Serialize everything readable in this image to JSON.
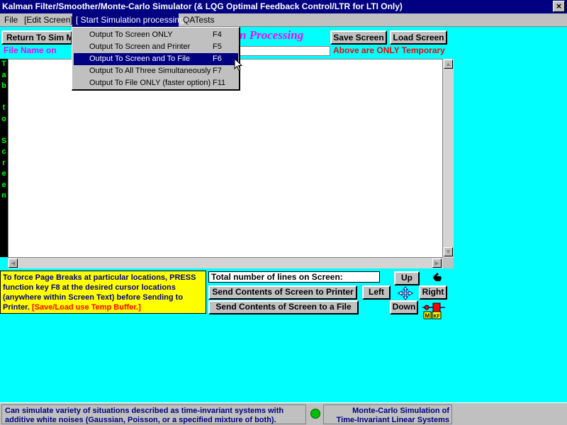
{
  "window": {
    "title": "Kalman Filter/Smoother/Monte-Carlo Simulator (& LQG Optimal Feedback Control/LTR for LTI Only)",
    "close_glyph": "×"
  },
  "menu": {
    "file": "File",
    "edit_screen": "[Edit Screen]",
    "start_sim": "[ Start Simulation processing ]",
    "qatests": "QATests"
  },
  "dropdown": {
    "items": [
      {
        "label": "Output To Screen ONLY",
        "key": "F4"
      },
      {
        "label": "Output To Screen and Printer",
        "key": "F5"
      },
      {
        "label": "Output To Screen and To File",
        "key": "F6"
      },
      {
        "label": "Output To All Three Simultaneously",
        "key": "F7"
      },
      {
        "label": "Output To File ONLY (faster option)",
        "key": "F11"
      }
    ],
    "selected_index": 2
  },
  "toolbar": {
    "return_label": "Return To Sim Menu",
    "processing_title": "n Processing",
    "save_screen": "Save Screen",
    "load_screen": "Load Screen",
    "file_name_label": "File Name on",
    "file_name_value": "",
    "temp_note": "Above are ONLY Temporary"
  },
  "tab_strip": {
    "letters": [
      "T",
      "a",
      "b",
      "",
      "t",
      "o",
      "",
      "S",
      "c",
      "r",
      "e",
      "e",
      "n"
    ]
  },
  "note": {
    "text": "To force Page Breaks at particular locations, PRESS function key F8 at the desired cursor locations (anywhere within Screen Text) before Sending to Printer.",
    "red_text": "[Save/Load use Temp Buffer.]"
  },
  "controls": {
    "total_lines_label": "Total number of lines on Screen:",
    "send_printer": "Send Contents of Screen to Printer",
    "send_file": "Send Contents of Screen to a File",
    "up": "Up",
    "left": "Left",
    "right": "Right",
    "down": "Down",
    "badge_m": "M",
    "badge_kf": "KF"
  },
  "status": {
    "left_text": "Can simulate variety of situations described as time-invariant systems with additive white noises (Gaussian, Poisson, or a specified mixture of both).",
    "right_line1": "Monte-Carlo Simulation of",
    "right_line2": "Time-Invariant Linear Systems"
  },
  "colors": {
    "background": "#00ffff",
    "titlebar": "#000080",
    "accent_magenta": "#ff00ff",
    "warning_red": "#ff0000",
    "note_yellow": "#ffff00",
    "status_green": "#00c000"
  }
}
